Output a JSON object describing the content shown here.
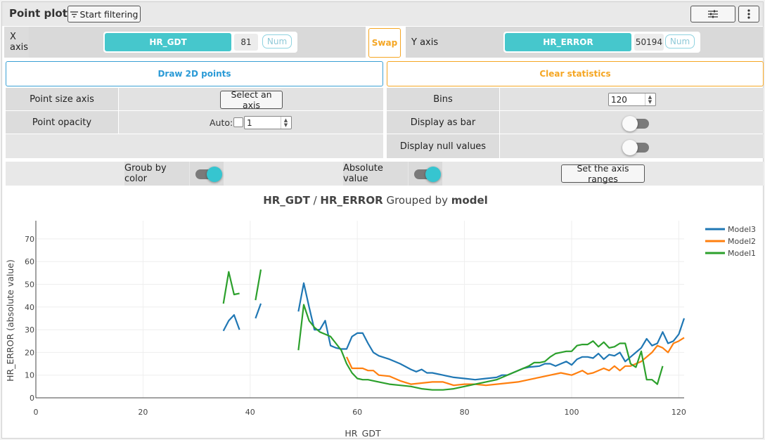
{
  "header": {
    "title": "Point plot",
    "filter_button": "Start filtering"
  },
  "axes": {
    "x_label": "X axis",
    "x_field": "HR_GDT",
    "x_count": "81",
    "x_type": "Num",
    "swap": "Swap",
    "y_label": "Y axis",
    "y_field": "HR_ERROR",
    "y_count": "50194",
    "y_type": "Num"
  },
  "actions": {
    "draw": "Draw 2D points",
    "clear": "Clear statistics"
  },
  "left_settings": {
    "point_size_label": "Point size axis",
    "point_size_button": "Select an axis",
    "opacity_label": "Point opacity",
    "opacity_auto": "Auto:",
    "opacity_value": "1"
  },
  "right_settings": {
    "bins_label": "Bins",
    "bins_value": "120",
    "bar_label": "Display as bar",
    "bar_on": false,
    "null_label": "Display null values",
    "null_on": false
  },
  "options": {
    "group_label": "Groub by color",
    "group_on": true,
    "abs_label": "Absolute value",
    "abs_on": true,
    "ranges_button": "Set the axis ranges"
  },
  "chart_data": {
    "type": "line",
    "title_parts": [
      "HR_GDT",
      " / ",
      "HR_ERROR",
      " Grouped by ",
      "model"
    ],
    "xlabel": "HR_GDT",
    "ylabel": "HR_ERROR (absolute value)",
    "xlim": [
      0,
      121
    ],
    "ylim": [
      0,
      78
    ],
    "xticks": [
      0,
      20,
      40,
      60,
      80,
      100,
      120
    ],
    "yticks": [
      0,
      10,
      20,
      30,
      40,
      50,
      60,
      70
    ],
    "grid": true,
    "legend_position": "top-right",
    "series": [
      {
        "name": "Model3",
        "color": "#1f77b4",
        "segments": [
          [
            [
              35,
              29.5
            ],
            [
              36,
              34
            ],
            [
              37,
              36.5
            ],
            [
              38,
              30
            ]
          ],
          [
            [
              41,
              35
            ],
            [
              42,
              41.5
            ]
          ],
          [
            [
              49,
              38
            ],
            [
              50,
              50.5
            ],
            [
              51,
              40
            ],
            [
              52,
              30
            ],
            [
              53,
              30
            ],
            [
              54,
              34
            ],
            [
              55,
              23
            ],
            [
              56,
              22
            ],
            [
              57,
              21.5
            ],
            [
              58,
              21.5
            ],
            [
              59,
              27
            ],
            [
              60,
              28.5
            ],
            [
              61,
              28.5
            ],
            [
              62,
              24
            ],
            [
              63,
              20
            ],
            [
              64,
              18.5
            ],
            [
              66,
              17
            ],
            [
              68,
              15
            ],
            [
              70,
              12.5
            ],
            [
              71,
              11.5
            ],
            [
              72,
              12.5
            ],
            [
              73,
              11
            ],
            [
              74,
              11
            ],
            [
              76,
              10
            ],
            [
              78,
              9
            ],
            [
              80,
              8.5
            ],
            [
              82,
              8
            ],
            [
              84,
              8.5
            ],
            [
              86,
              9
            ],
            [
              87,
              10
            ],
            [
              88,
              10
            ],
            [
              90,
              12
            ],
            [
              91,
              13
            ],
            [
              92,
              13.5
            ],
            [
              94,
              14
            ],
            [
              95,
              15
            ],
            [
              96,
              15
            ],
            [
              97,
              14
            ],
            [
              98,
              15
            ],
            [
              99,
              16
            ],
            [
              100,
              14.5
            ],
            [
              101,
              17
            ],
            [
              102,
              18
            ],
            [
              103,
              18
            ],
            [
              104,
              17.5
            ],
            [
              105,
              19.5
            ],
            [
              106,
              17
            ],
            [
              107,
              19
            ],
            [
              108,
              18.5
            ],
            [
              109,
              20
            ],
            [
              110,
              16
            ],
            [
              111,
              18
            ],
            [
              112,
              20
            ],
            [
              113,
              22
            ],
            [
              114,
              26
            ],
            [
              115,
              23
            ],
            [
              116,
              24
            ],
            [
              117,
              29
            ],
            [
              118,
              24
            ],
            [
              119,
              25
            ],
            [
              120,
              28
            ],
            [
              121,
              35
            ]
          ]
        ]
      },
      {
        "name": "Model2",
        "color": "#ff7f0e",
        "segments": [
          [
            [
              58,
              18
            ],
            [
              59,
              13
            ],
            [
              60,
              13
            ],
            [
              61,
              13
            ],
            [
              62,
              12
            ],
            [
              63,
              12
            ],
            [
              64,
              10
            ],
            [
              66,
              9.5
            ],
            [
              68,
              7.5
            ],
            [
              70,
              6
            ],
            [
              72,
              6.5
            ],
            [
              74,
              7
            ],
            [
              76,
              7
            ],
            [
              78,
              5.5
            ],
            [
              80,
              6
            ],
            [
              82,
              6
            ],
            [
              84,
              5.5
            ],
            [
              86,
              6
            ],
            [
              88,
              6.5
            ],
            [
              90,
              7
            ],
            [
              92,
              8
            ],
            [
              94,
              9
            ],
            [
              96,
              10
            ],
            [
              98,
              11
            ],
            [
              100,
              10
            ],
            [
              101,
              11
            ],
            [
              102,
              12
            ],
            [
              103,
              10.5
            ],
            [
              104,
              11
            ],
            [
              106,
              13
            ],
            [
              107,
              12
            ],
            [
              108,
              14
            ],
            [
              109,
              12
            ],
            [
              110,
              14
            ],
            [
              111,
              14
            ],
            [
              112,
              15
            ],
            [
              113,
              16
            ],
            [
              114,
              18
            ],
            [
              115,
              20
            ],
            [
              116,
              23
            ],
            [
              117,
              22
            ],
            [
              118,
              20
            ],
            [
              119,
              24
            ],
            [
              120,
              25
            ],
            [
              121,
              26.5
            ]
          ]
        ]
      },
      {
        "name": "Model1",
        "color": "#2ca02c",
        "segments": [
          [
            [
              35,
              41.5
            ],
            [
              36,
              55.5
            ],
            [
              37,
              45.5
            ],
            [
              38,
              46
            ]
          ],
          [
            [
              41,
              43
            ],
            [
              42,
              56.5
            ]
          ],
          [
            [
              49,
              21
            ],
            [
              50,
              41
            ],
            [
              51,
              34
            ],
            [
              52,
              31
            ],
            [
              53,
              29
            ],
            [
              54,
              28
            ],
            [
              55,
              27
            ],
            [
              56,
              24
            ],
            [
              57,
              21
            ],
            [
              58,
              15
            ],
            [
              59,
              11
            ],
            [
              60,
              8.5
            ],
            [
              61,
              8
            ],
            [
              62,
              8
            ],
            [
              63,
              7.5
            ],
            [
              64,
              7
            ],
            [
              66,
              6
            ],
            [
              68,
              5.5
            ],
            [
              70,
              5
            ],
            [
              72,
              4
            ],
            [
              74,
              3.5
            ],
            [
              76,
              3.5
            ],
            [
              78,
              4
            ],
            [
              80,
              5
            ],
            [
              82,
              6
            ],
            [
              84,
              7
            ],
            [
              86,
              8
            ],
            [
              88,
              10
            ],
            [
              90,
              12
            ],
            [
              92,
              14
            ],
            [
              93,
              15.5
            ],
            [
              94,
              15.5
            ],
            [
              95,
              16
            ],
            [
              96,
              18
            ],
            [
              97,
              19.5
            ],
            [
              98,
              20
            ],
            [
              99,
              20.5
            ],
            [
              100,
              20.5
            ],
            [
              101,
              23
            ],
            [
              102,
              23.5
            ],
            [
              103,
              23.5
            ],
            [
              104,
              25
            ],
            [
              105,
              22.5
            ],
            [
              106,
              24.5
            ],
            [
              107,
              22
            ],
            [
              108,
              22.5
            ],
            [
              109,
              24
            ],
            [
              110,
              24
            ],
            [
              111,
              15
            ],
            [
              112,
              13.5
            ],
            [
              113,
              20.5
            ],
            [
              114,
              8
            ],
            [
              115,
              8
            ],
            [
              116,
              6
            ],
            [
              117,
              14
            ]
          ]
        ]
      }
    ]
  }
}
